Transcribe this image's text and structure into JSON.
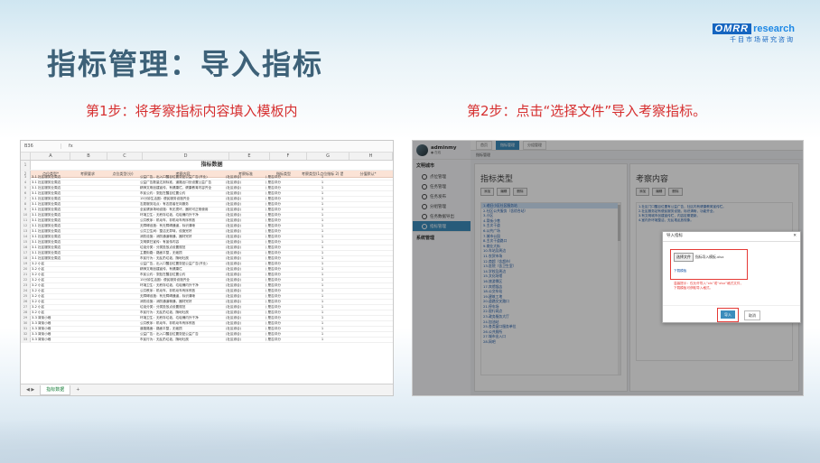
{
  "slide": {
    "title": "指标管理：导入指标",
    "step1": "第1步：将考察指标内容填入模板内",
    "step2": "第2步：点击“选择文件”导入考察指标。"
  },
  "logo": {
    "brand": "OMRR",
    "word": "research",
    "subtitle": "千目市场研究咨询"
  },
  "spreadsheet": {
    "cell_ref": "B36",
    "formula_prefix": "fx",
    "columns": [
      "A",
      "B",
      "C",
      "D",
      "E",
      "F",
      "G",
      "H"
    ],
    "title": "指标数据",
    "headers": [
      "点位类型*",
      "考察要求",
      "点位类型(分)",
      "考察内容",
      "考察标准",
      "指标类型",
      "考察类型(1点位指标 2) 是否计分",
      "分值默认*"
    ],
    "rows": [
      {
        "a": "3-1 社区服务业周边",
        "d": "公益广告，出入口醒目位置张贴公益广告(开业)",
        "e": "(社区综合)",
        "f": ") 是否评分",
        "g": "1"
      },
      {
        "a": "3-1 社区服务业周边",
        "d": "公益广告数量达到标准，道路出口处设置公益广告",
        "e": "(社区综合)",
        "f": ") 是否评分",
        "g": "1"
      },
      {
        "a": "3-1 社区服务业周边",
        "d": "精神文明创建宣传，有健康栏，健康教育内容齐全",
        "e": "(社区综合)",
        "f": ") 是否评分",
        "g": "1"
      },
      {
        "a": "3-1 社区服务业周边",
        "d": "市民公约：张贴在醒目位置公约",
        "e": "(社区综合)",
        "f": ") 是否评分",
        "g": "1"
      },
      {
        "a": "3-1 社区服务业周边",
        "d": "15分钟生活圈：便民服务设施齐全",
        "e": "(社区综合)",
        "f": ") 是否评分",
        "g": "1"
      },
      {
        "a": "3-1 社区服务业周边",
        "d": "志愿服务站点：有志愿者在岗服务",
        "e": "(社区综合)",
        "f": ") 是否评分",
        "g": "1"
      },
      {
        "a": "3-1 社区服务业周边",
        "d": "全民健身场地设施：有无损坏，器材可正常使用",
        "e": "(社区综合)",
        "f": ") 是否评分",
        "g": "1"
      },
      {
        "a": "3-1 社区服务业周边",
        "d": "环境卫生：无积存垃圾、垃圾桶内外干净",
        "e": "(社区综合)",
        "f": ") 是否评分",
        "g": "1"
      },
      {
        "a": "3-1 社区服务业周边",
        "d": "公共秩序：机动车、非机动车有序停放",
        "e": "(社区综合)",
        "f": ") 是否评分",
        "g": "1"
      },
      {
        "a": "3-1 社区服务业周边",
        "d": "无障碍设施：有无障碍通道，标识清晰",
        "e": "(社区综合)",
        "f": ") 是否评分",
        "g": "1"
      },
      {
        "a": "3-1 社区服务业周边",
        "d": "公共卫生间：整洁无异味，设施完好",
        "e": "(社区综合)",
        "f": ") 是否评分",
        "g": "1"
      },
      {
        "a": "3-1 社区服务业周边",
        "d": "消防设施：消防通道畅通，器材完好",
        "e": "(社区综合)",
        "f": ") 是否评分",
        "g": "1"
      },
      {
        "a": "3-1 社区服务业周边",
        "d": "文明祭扫宣传：有宣传内容",
        "e": "(社区综合)",
        "f": ") 是否评分",
        "g": "1"
      },
      {
        "a": "3-1 社区服务业周边",
        "d": "垃圾分类：分类投放点设置规范",
        "e": "(社区综合)",
        "f": ") 是否评分",
        "g": "1"
      },
      {
        "a": "3-1 社区服务业周边",
        "d": "主要街路：路面平整，无破损",
        "e": "(社区综合)",
        "f": ") 是否评分",
        "g": "1"
      },
      {
        "a": "3-1 社区服务业周边",
        "d": "市民行为：无乱扔垃圾、随地吐痰",
        "e": "(社区综合)",
        "f": ") 是否评分",
        "g": "1"
      },
      {
        "a": "3-2 小区",
        "d": "公益广告，出入口醒目位置张贴公益广告(开业)",
        "e": "(社区综合)",
        "f": ") 是否评分",
        "g": "1"
      },
      {
        "a": "3-2 小区",
        "d": "精神文明创建宣传，有健康栏",
        "e": "(社区综合)",
        "f": ") 是否评分",
        "g": "1"
      },
      {
        "a": "3-2 小区",
        "d": "市民公约：张贴在醒目位置公约",
        "e": "(社区综合)",
        "f": ") 是否评分",
        "g": "1"
      },
      {
        "a": "3-2 小区",
        "d": "15分钟生活圈：便民服务设施齐全",
        "e": "(社区综合)",
        "f": ") 是否评分",
        "g": "1"
      },
      {
        "a": "3-2 小区",
        "d": "环境卫生：无积存垃圾、垃圾桶内外干净",
        "e": "(社区综合)",
        "f": ") 是否评分",
        "g": "1"
      },
      {
        "a": "3-2 小区",
        "d": "公共秩序：机动车、非机动车有序停放",
        "e": "(社区综合)",
        "f": ") 是否评分",
        "g": "1"
      },
      {
        "a": "3-2 小区",
        "d": "无障碍设施：有无障碍通道，标识清晰",
        "e": "(社区综合)",
        "f": ") 是否评分",
        "g": "1"
      },
      {
        "a": "3-2 小区",
        "d": "消防设施：消防通道畅通，器材完好",
        "e": "(社区综合)",
        "f": ") 是否评分",
        "g": "1"
      },
      {
        "a": "3-2 小区",
        "d": "垃圾分类：分类投放点设置规范",
        "e": "(社区综合)",
        "f": ") 是否评分",
        "g": "1"
      },
      {
        "a": "3-2 小区",
        "d": "市民行为：无乱扔垃圾、随地吐痰",
        "e": "(社区综合)",
        "f": ") 是否评分",
        "g": "1"
      },
      {
        "a": "3-3 背街小巷",
        "d": "环境卫生：无积存垃圾、垃圾桶内外干净",
        "e": "(社区综合)",
        "f": ") 是否评分",
        "g": "1"
      },
      {
        "a": "3-3 背街小巷",
        "d": "公共秩序：机动车、非机动车有序停放",
        "e": "(社区综合)",
        "f": ") 是否评分",
        "g": "1"
      },
      {
        "a": "3-3 背街小巷",
        "d": "道路路面：路面平整，无破损",
        "e": "(社区综合)",
        "f": ") 是否评分",
        "g": "1"
      },
      {
        "a": "3-3 背街小巷",
        "d": "公益广告：出入口醒目位置张贴公益广告",
        "e": "(社区综合)",
        "f": ") 是否评分",
        "g": "1"
      },
      {
        "a": "3-3 背街小巷",
        "d": "市民行为：无乱扔垃圾、随地吐痰",
        "e": "(社区综合)",
        "f": ") 是否评分",
        "g": "1"
      }
    ],
    "sheet_tab": "指标数据",
    "add_sheet": "+"
  },
  "app": {
    "user": {
      "name": "adminmy",
      "status": "● 在线"
    },
    "menu_group": "文明城市",
    "menu_items": [
      "点位管理",
      "任务管理",
      "任务发布",
      "分组管理",
      "任务数据导出",
      "指标管理"
    ],
    "active_menu": 5,
    "menu_group2": "系统管理",
    "top_tabs": [
      "首页",
      "指标管理",
      "分组管理"
    ],
    "breadcrumb": "指标管理",
    "left_panel": {
      "title": "指标类型",
      "buttons": [
        "添加",
        "编辑",
        "删除"
      ],
      "items": [
        "1.老旧小区社区服务站",
        "2.社区公共服务（含综合站）",
        "3.小区",
        "4.背街小巷",
        "5.主次干道",
        "6.公共广场",
        "7.城市公园",
        "8.主次干道路口",
        "9.商业大街",
        "10.车站及周边",
        "11.农贸市场",
        "12.商超（含超市）",
        "13.医院（含卫生室）",
        "14.学校及周边",
        "15.文化场馆",
        "16.旅游景区",
        "17.宾馆饭店",
        "18.公交车站",
        "19.建筑工地",
        "20.道路交叉路口",
        "21.停车场",
        "22.银行网点",
        "23.政务服务大厅",
        "24.加油站",
        "25.各类窗口服务单位",
        "26.公共厕所",
        "27.城市出入口",
        "28.网吧"
      ]
    },
    "right_panel": {
      "title": "考察内容",
      "buttons": [
        "添加",
        "编辑",
        "删除"
      ],
      "lines": [
        "1.社区门口醒目位置有公益广告，社区内有健康教育宣传栏。",
        "2.社区服务站有便民服务设施，标识清晰，功能齐全。",
        "3.有文明城市创建宣传栏，内容定期更新。",
        "4.室内外环境整洁，无乱堆乱放现象。"
      ]
    },
    "dialog": {
      "title": "导入指标",
      "close": "✕",
      "choose_file": "选择文件",
      "file_name": "指标导入模板.xlsx",
      "download_template": "下载模板",
      "warning": "温馨提示：仅允许导入“xls”或“xlsx”格式文件，下载模板可获取导入格式。",
      "import_button": "导入",
      "cancel_button": "取消"
    }
  }
}
